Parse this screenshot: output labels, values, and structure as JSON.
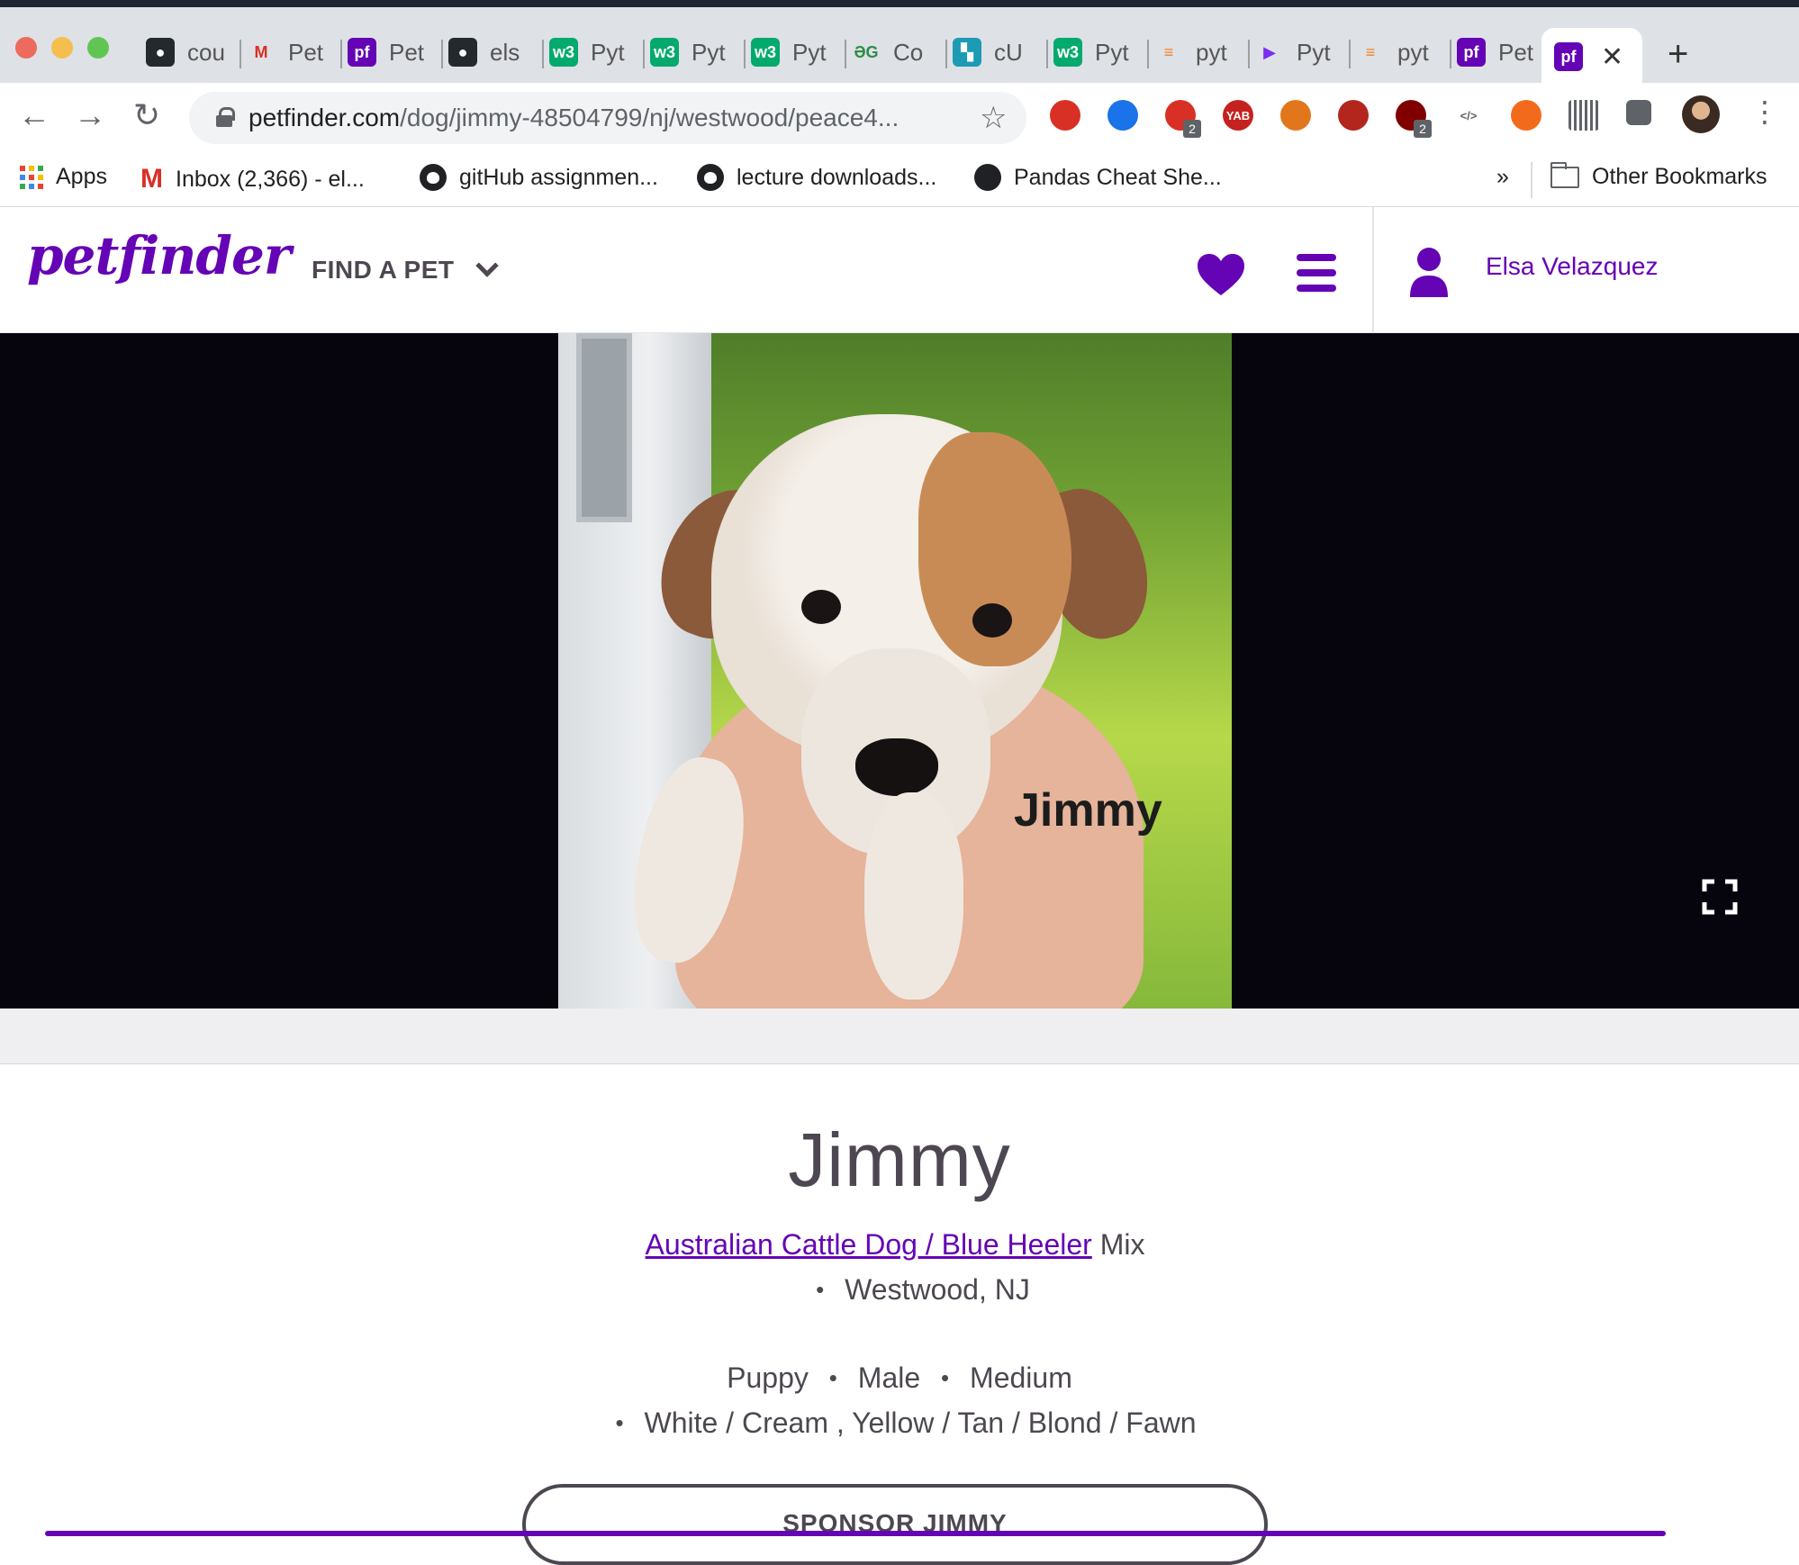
{
  "browser": {
    "tabs": [
      {
        "label": "cou",
        "icon": "github-icon"
      },
      {
        "label": "Pet",
        "icon": "gmail-icon"
      },
      {
        "label": "Pet",
        "icon": "petfinder-icon"
      },
      {
        "label": "els",
        "icon": "github-icon"
      },
      {
        "label": "Pyt",
        "icon": "w3schools-icon"
      },
      {
        "label": "Pyt",
        "icon": "w3schools-icon"
      },
      {
        "label": "Pyt",
        "icon": "w3schools-icon"
      },
      {
        "label": "Co",
        "icon": "geeksforgeeks-icon"
      },
      {
        "label": "cU",
        "icon": "bookmark-app-icon"
      },
      {
        "label": "Pyt",
        "icon": "w3schools-icon"
      },
      {
        "label": "pyt",
        "icon": "stackoverflow-icon"
      },
      {
        "label": "Pyt",
        "icon": "pycharm-icon"
      },
      {
        "label": "pyt",
        "icon": "stackoverflow-icon"
      },
      {
        "label": "Pet",
        "icon": "petfinder-icon"
      }
    ],
    "url_domain": "petfinder.com",
    "url_path": "/dog/jimmy-48504799/nj/westwood/peace4...",
    "extensions": [
      {
        "icon": "target-icon",
        "color": "#d93025",
        "label": ""
      },
      {
        "icon": "block-icon",
        "color": "#1a73e8",
        "label": ""
      },
      {
        "icon": "grammarly-icon",
        "color": "#d93025",
        "label": "",
        "badge": "2"
      },
      {
        "icon": "yab-icon",
        "color": "#c5221f",
        "label": "YAB"
      },
      {
        "icon": "metamask-icon",
        "color": "#e2761b",
        "label": ""
      },
      {
        "icon": "audio-icon",
        "color": "#b3261e",
        "label": ""
      },
      {
        "icon": "ublock-icon",
        "color": "#800000",
        "label": "",
        "badge": "2"
      },
      {
        "icon": "code-icon",
        "color": "#5f6368",
        "label": "</>"
      },
      {
        "icon": "lifebuoy-icon",
        "color": "#f26b1d",
        "label": ""
      },
      {
        "icon": "barcode-icon",
        "color": "#5f6368",
        "label": ""
      },
      {
        "icon": "puzzle-icon",
        "color": "#5f6368",
        "label": ""
      }
    ],
    "bookmarks": [
      {
        "label": "Apps",
        "icon": "apps-icon"
      },
      {
        "label": "Inbox (2,366) - el...",
        "icon": "gmail-icon"
      },
      {
        "label": "gitHub assignmen...",
        "icon": "github-icon"
      },
      {
        "label": "lecture downloads...",
        "icon": "github-icon"
      },
      {
        "label": "Pandas Cheat She...",
        "icon": "pandas-icon"
      }
    ],
    "bookmarks_overflow": "»",
    "other_bookmarks": "Other Bookmarks"
  },
  "site": {
    "logo": "petfinder",
    "find_a_pet": "FIND A PET",
    "user_name": "Elsa Velazquez",
    "brand_color": "#6504b5"
  },
  "photo": {
    "caption": "Jimmy"
  },
  "pet": {
    "name": "Jimmy",
    "breed": "Australian Cattle Dog / Blue Heeler",
    "breed_suffix": "Mix",
    "location": "Westwood, NJ",
    "age": "Puppy",
    "gender": "Male",
    "size": "Medium",
    "colors": "White / Cream , Yellow / Tan / Blond / Fawn",
    "sponsor_label": "SPONSOR JIMMY"
  }
}
